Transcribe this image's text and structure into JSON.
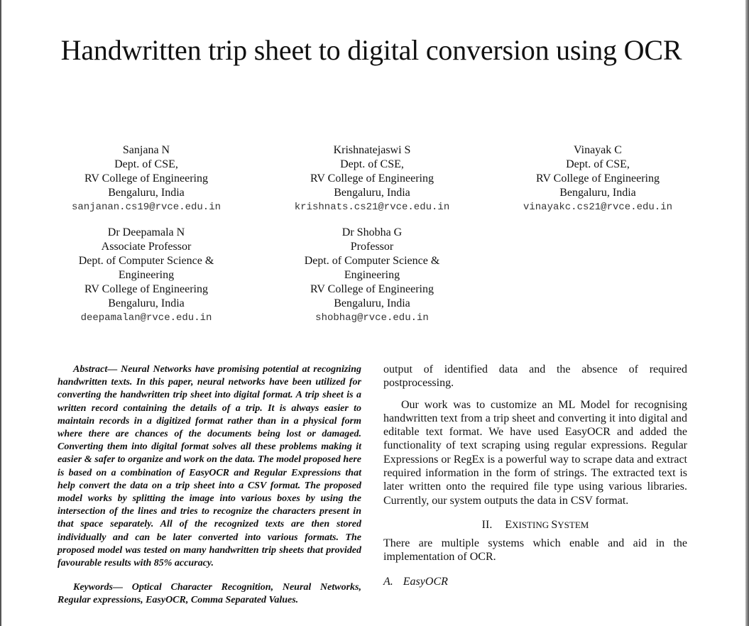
{
  "paper": {
    "title": "Handwritten trip sheet to digital conversion using OCR",
    "authors": [
      {
        "name": "Sanjana N",
        "lines": [
          "Dept. of CSE,",
          "RV College of Engineering",
          "Bengaluru, India"
        ],
        "email": "sanjanan.cs19@rvce.edu.in"
      },
      {
        "name": "Krishnatejaswi S",
        "lines": [
          "Dept. of CSE,",
          "RV College of Engineering",
          "Bengaluru, India"
        ],
        "email": "krishnats.cs21@rvce.edu.in"
      },
      {
        "name": "Vinayak C",
        "lines": [
          "Dept. of CSE,",
          "RV College of Engineering",
          "Bengaluru, India"
        ],
        "email": "vinayakc.cs21@rvce.edu.in"
      },
      {
        "name": "Dr Deepamala N",
        "lines": [
          "Associate Professor",
          "Dept. of Computer Science &",
          "Engineering",
          "RV College of Engineering",
          "Bengaluru, India"
        ],
        "email": "deepamalan@rvce.edu.in"
      },
      {
        "name": "Dr Shobha G",
        "lines": [
          "Professor",
          "Dept. of Computer Science &",
          "Engineering",
          "RV College of Engineering",
          "Bengaluru, India"
        ],
        "email": "shobhag@rvce.edu.in"
      }
    ],
    "abstract": "Abstract— Neural Networks have promising potential at recognizing handwritten texts. In this paper, neural networks have been utilized for converting the handwritten trip sheet into digital format. A trip sheet is a written record containing the details of a trip. It is always easier to maintain records in a digitized format rather than in a physical form where there are chances of the documents being lost or damaged. Converting them into digital format solves all these problems making it easier & safer to organize and work on the data. The model proposed here is based on a combination of EasyOCR and Regular Expressions that help convert the data on a trip sheet into a CSV format. The proposed model works by splitting the image into various boxes by using the intersection of the lines and tries to recognize the characters present in that space separately. All of the recognized texts are then stored individually and can be later converted into various formats. The proposed model was tested on many handwritten trip sheets that provided favourable results with 85% accuracy.",
    "keywords": "Keywords— Optical Character Recognition, Neural Networks, Regular expressions, EasyOCR, Comma Separated Values.",
    "right_column": {
      "para1": "output of identified data and the absence of required postprocessing.",
      "para2": "Our work was to customize an ML Model for recognising handwritten text from a trip sheet and converting it into digital and editable text format. We have used EasyOCR and added the functionality of text scraping using regular expressions. Regular Expressions or RegEx is a powerful way to scrape data and extract required information in the form of strings. The extracted text is later written onto the required file type using various libraries. Currently, our system outputs the data in CSV format.",
      "section_number": "II.",
      "section_title_cap1": "E",
      "section_title_rest1": "XISTING ",
      "section_title_cap2": "S",
      "section_title_rest2": "YSTEM",
      "para3": "There are multiple systems which enable and aid in the implementation of OCR.",
      "subsection_number": "A.",
      "subsection_title": "EasyOCR"
    }
  }
}
